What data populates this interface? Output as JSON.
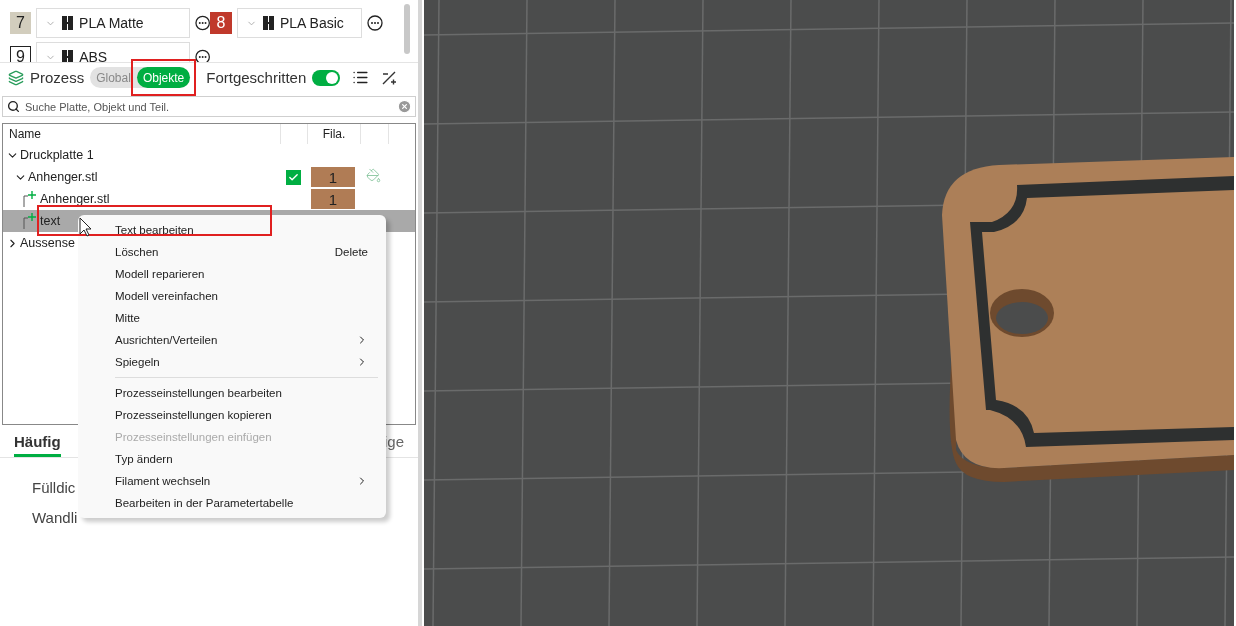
{
  "filaments": [
    {
      "number": "7",
      "color": "#d2cdbd",
      "name": "PLA Matte"
    },
    {
      "number": "8",
      "color": "#c0392b",
      "name": "PLA Basic"
    },
    {
      "number": "9",
      "color": "#ffffff",
      "name": "ABS"
    }
  ],
  "process": {
    "title": "Prozess",
    "modes": [
      {
        "label": "Global",
        "selected": false,
        "highlighted": false
      },
      {
        "label": "Objekte",
        "selected": true,
        "highlighted": true
      }
    ],
    "advanced_label": "Fortgeschritten",
    "advanced_on": true
  },
  "search": {
    "placeholder": "Suche Platte, Objekt und Teil."
  },
  "object_list": {
    "columns": [
      "Name",
      "Fila."
    ],
    "items": [
      {
        "name": "Druckplatte 1",
        "expanded": true,
        "selected": false,
        "children": [
          {
            "name": "Anhenger.stl",
            "expanded": true,
            "selected": false,
            "checked": true,
            "filament": "1",
            "children": [
              {
                "name": "Anhenger.stl",
                "selected": false,
                "filament": "1"
              },
              {
                "name": "text",
                "selected": true
              }
            ]
          }
        ]
      },
      {
        "name": "Aussense",
        "expanded": false,
        "selected": false
      }
    ]
  },
  "tabs": [
    {
      "label": "Häufig",
      "selected": true
    },
    {
      "label": "ige",
      "selected": false
    }
  ],
  "settings": [
    "Fülldic",
    "Wandli"
  ],
  "context_menu": [
    {
      "label": "Text bearbeiten",
      "highlighted": true
    },
    {
      "label": "Löschen",
      "shortcut": "Delete"
    },
    {
      "label": "Modell reparieren"
    },
    {
      "label": "Modell vereinfachen"
    },
    {
      "label": "Mitte"
    },
    {
      "label": "Ausrichten/Verteilen",
      "submenu": true
    },
    {
      "label": "Spiegeln",
      "submenu": true
    },
    {
      "label": "Prozesseinstellungen bearbeiten",
      "separator_before": true
    },
    {
      "label": "Prozesseinstellungen kopieren"
    },
    {
      "label": "Prozesseinstellungen einfügen",
      "disabled": true
    },
    {
      "label": "Typ ändern"
    },
    {
      "label": "Filament wechseln",
      "submenu": true
    },
    {
      "label": "Bearbeiten in der Parametertabelle"
    }
  ]
}
